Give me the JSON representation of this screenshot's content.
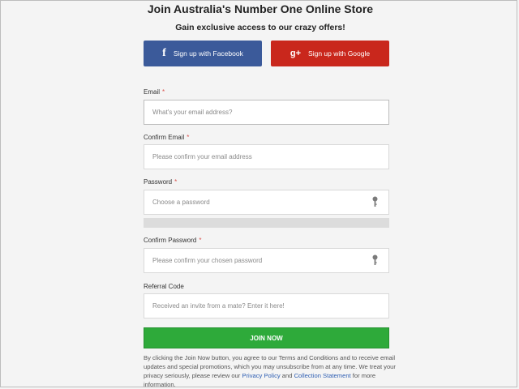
{
  "header": {
    "title": "Join Australia's Number One Online Store",
    "subtitle": "Gain exclusive access to our crazy offers!"
  },
  "social": {
    "facebook_label": "Sign up with Facebook",
    "facebook_glyph": "f",
    "google_label": "Sign up with Google",
    "google_glyph": "g+",
    "facebook_color": "#3b5a9a",
    "google_color": "#c9271c"
  },
  "form": {
    "required_mark": "*",
    "email": {
      "label": "Email",
      "placeholder": "What's your email address?",
      "value": ""
    },
    "confirm_email": {
      "label": "Confirm Email",
      "placeholder": "Please confirm your email address",
      "value": ""
    },
    "password": {
      "label": "Password",
      "placeholder": "Choose a password",
      "value": ""
    },
    "confirm_password": {
      "label": "Confirm Password",
      "placeholder": "Please confirm your chosen password",
      "value": ""
    },
    "referral": {
      "label": "Referral Code",
      "placeholder": "Received an invite from a mate? Enter it here!",
      "value": ""
    },
    "join_label": "JOIN NOW",
    "join_color": "#2eaa3a"
  },
  "terms": {
    "text_before": "By clicking the Join Now button, you agree to our Terms and Conditions and to receive email updates and special promotions, which you may unsubscribe from at any time. We treat your privacy seriously, please review our ",
    "privacy_link": "Privacy Policy",
    "text_middle": " and ",
    "collection_link": "Collection Statement",
    "text_after": " for more information."
  }
}
